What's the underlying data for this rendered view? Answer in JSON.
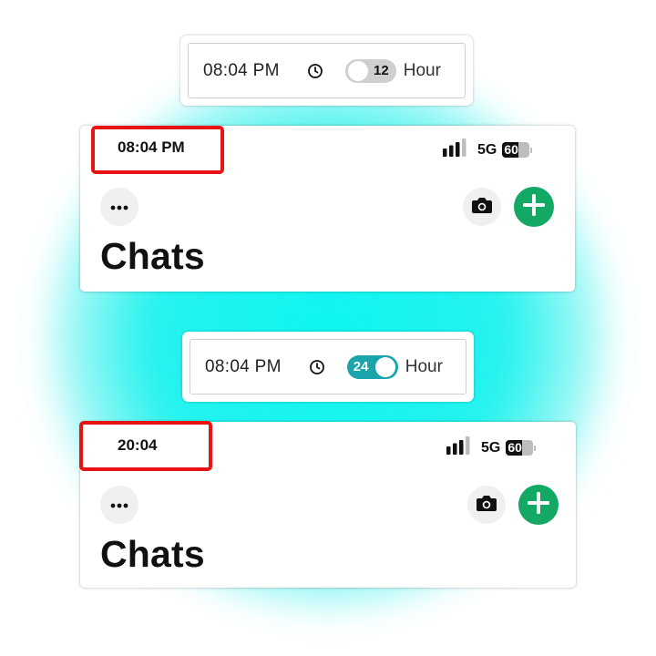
{
  "panels": [
    {
      "bar": {
        "time": "08:04  PM",
        "toggle_value": "12",
        "toggle_state": "off",
        "unit_label": "Hour"
      },
      "phone": {
        "status_time": "08:04 PM",
        "network": "5G",
        "battery": "60",
        "title": "Chats"
      }
    },
    {
      "bar": {
        "time": "08:04  PM",
        "toggle_value": "24",
        "toggle_state": "on",
        "unit_label": "Hour"
      },
      "phone": {
        "status_time": "20:04",
        "network": "5G",
        "battery": "60",
        "title": "Chats"
      }
    }
  ],
  "colors": {
    "toggle_on": "#1aa5ad",
    "toggle_off": "#cfcfcf",
    "highlight": "#e81313",
    "add_button": "#14a865",
    "glow": "#00f5f0"
  },
  "icons": {
    "clock": "clock-icon",
    "signal": "signal-bars-icon",
    "battery": "battery-icon",
    "more": "more-horizontal-icon",
    "camera": "camera-icon",
    "add": "plus-icon"
  }
}
